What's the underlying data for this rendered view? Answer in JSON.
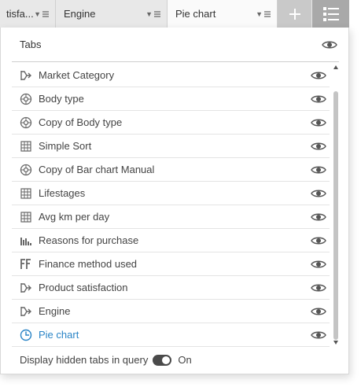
{
  "tabs": [
    {
      "label": "tisfa...",
      "active": false
    },
    {
      "label": "Engine",
      "active": false
    },
    {
      "label": "Pie chart",
      "active": true
    }
  ],
  "toolbar": {
    "add_icon": "plus-icon",
    "list_icon": "list-icon"
  },
  "panel": {
    "title": "Tabs",
    "items": [
      {
        "label": "Market Category",
        "icon": "flow-icon"
      },
      {
        "label": "Body type",
        "icon": "donut-icon"
      },
      {
        "label": "Copy of Body type",
        "icon": "donut-icon"
      },
      {
        "label": "Simple Sort",
        "icon": "grid-icon"
      },
      {
        "label": "Copy of Bar chart Manual",
        "icon": "donut-icon"
      },
      {
        "label": "Lifestages",
        "icon": "grid-icon"
      },
      {
        "label": "Avg km per day",
        "icon": "grid-icon"
      },
      {
        "label": "Reasons for purchase",
        "icon": "bar-chart-icon"
      },
      {
        "label": "Finance method used",
        "icon": "ff-icon"
      },
      {
        "label": "Product satisfaction",
        "icon": "flow-icon"
      },
      {
        "label": "Engine",
        "icon": "flow-icon"
      },
      {
        "label": "Pie chart",
        "icon": "pie-clock-icon",
        "active": true
      }
    ]
  },
  "footer": {
    "label": "Display hidden tabs in query",
    "toggle_state": "On",
    "toggle_on": true
  },
  "colors": {
    "accent": "#2a84c6",
    "tabbar": "#e8e8e8"
  }
}
